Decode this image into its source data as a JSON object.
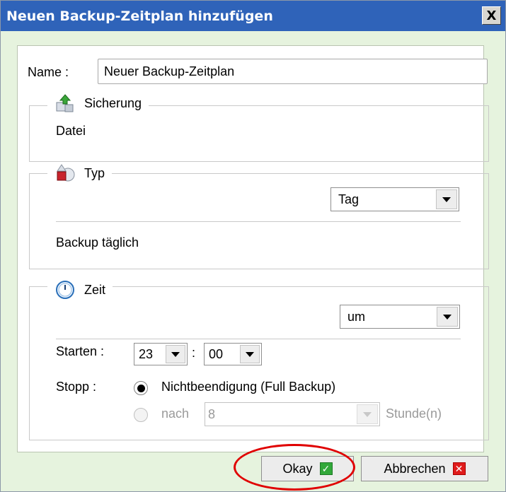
{
  "window": {
    "title": "Neuen Backup-Zeitplan hinzufügen",
    "close_glyph": "X"
  },
  "name": {
    "label": "Name :",
    "value": "Neuer Backup-Zeitplan"
  },
  "sicherung": {
    "legend": "Sicherung",
    "value": "Datei",
    "icon": "backup-boxes-icon"
  },
  "typ": {
    "legend": "Typ",
    "select_value": "Tag",
    "description": "Backup täglich",
    "icon": "type-shapes-icon"
  },
  "zeit": {
    "legend": "Zeit",
    "icon": "clock-icon",
    "mode_select_value": "um",
    "start_label": "Starten :",
    "start_hour": "23",
    "time_separator": ":",
    "start_minute": "00",
    "stop_label": "Stopp :",
    "stop_option_1": "Nichtbeendigung (Full Backup)",
    "stop_option_2_prefix": "nach",
    "stop_hours_value": "8",
    "stop_hours_unit": "Stunde(n)",
    "stop_option_1_selected": true
  },
  "footer": {
    "ok_label": "Okay",
    "cancel_label": "Abbrechen"
  },
  "colors": {
    "title_bar": "#2f63b9",
    "dialog_bg": "#e6f3de",
    "highlight": "#e00000",
    "ok_check": "#32a83a",
    "cancel_x": "#e01c1c"
  }
}
